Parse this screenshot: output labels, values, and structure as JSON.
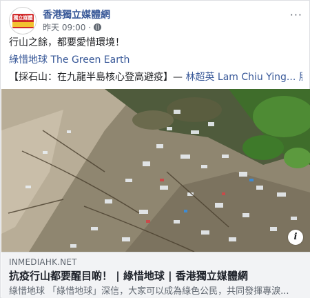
{
  "post": {
    "page_name": "香港獨立媒體網",
    "time": "昨天 09:00",
    "separator": "·",
    "more_label": "···",
    "avatar_logo_text": "獨立媒體",
    "text_line1": "行山之餘，都要愛惜環境！",
    "text_line2": "綠惜地球 The Green Earth",
    "text_line3_main": "【採石山：在九龍半島核心登高避疫】— ",
    "text_line3_author": "林超英 Lam Chiu Ying...",
    "text_line3_more": " 展开"
  },
  "photo": {
    "info_label": "i"
  },
  "link_preview": {
    "domain": "INMEDIAHK.NET",
    "title": "抗疫行山都要醒目啲！ | 綠惜地球 | 香港獨立媒體網",
    "description": "綠惜地球 「綠惜地球」深信，大家可以成為綠色公民，共同發揮專淚..."
  },
  "colors": {
    "link_blue": "#385898",
    "text_dark": "#1c1e21",
    "meta_gray": "#606770",
    "preview_bg": "#f2f3f5",
    "logo_red": "#d12a2a"
  }
}
